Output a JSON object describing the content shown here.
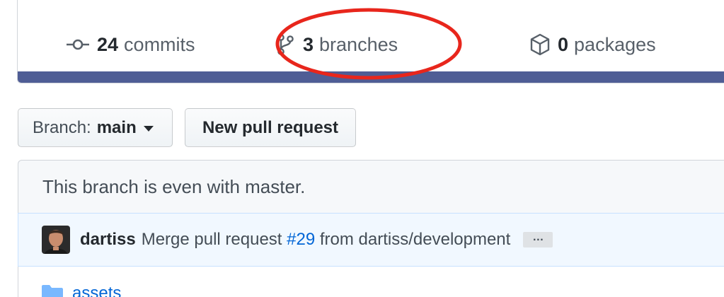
{
  "summary": {
    "commits": {
      "count": "24",
      "label": "commits",
      "icon": "commit-icon"
    },
    "branches": {
      "count": "3",
      "label": "branches",
      "icon": "git-branch-icon"
    },
    "packages": {
      "count": "0",
      "label": "packages",
      "icon": "package-icon"
    },
    "language_bar_color": "#4f5d95",
    "highlight_color": "#e8261c"
  },
  "toolbar": {
    "branch_prefix": "Branch:",
    "branch_name": "main",
    "new_pr_label": "New pull request"
  },
  "compare": {
    "status_text": "This branch is even with master."
  },
  "latest_commit": {
    "author": "dartiss",
    "message_before": "Merge pull request",
    "pr_link": "#29",
    "message_after": "from dartiss/development",
    "ellipsis": "…"
  },
  "files": [
    {
      "name": "assets",
      "type": "folder"
    }
  ]
}
